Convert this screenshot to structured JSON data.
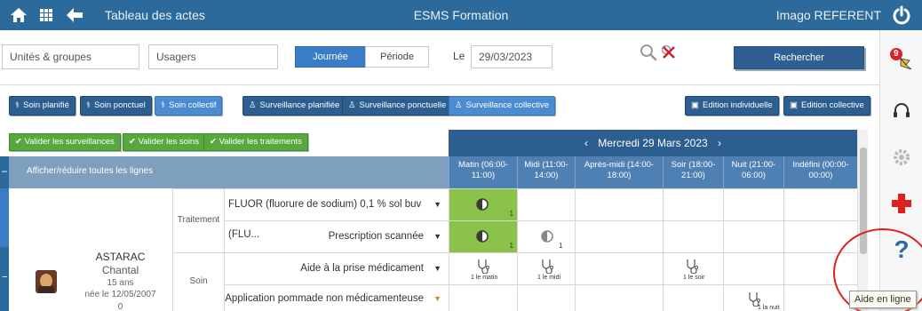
{
  "topbar": {
    "title": "Tableau des actes",
    "center_title": "ESMS Formation",
    "user": "Imago REFERENT"
  },
  "filters": {
    "units_placeholder": "Unités & groupes",
    "users_placeholder": "Usagers",
    "mode_day": "Journée",
    "mode_period": "Période",
    "date_label": "Le",
    "date_value": "29/03/2023",
    "search_label": "Rechercher",
    "notif_count": "9"
  },
  "actions": {
    "soin_planifie": "Soin planifié",
    "soin_ponctuel": "Soin ponctuel",
    "soin_collectif": "Soin collectif",
    "surv_planifiee": "Surveillance planifiée",
    "surv_ponctuelle": "Surveillance ponctuelle",
    "surv_collective": "Surveillance collective",
    "edition_individuelle": "Edition individuelle",
    "edition_collective": "Edition collective"
  },
  "validate": {
    "surveillances": "Valider les surveillances",
    "soins": "Valider les soins",
    "traitements": "Valider les traitements"
  },
  "calendar": {
    "prev": "‹",
    "date": "Mercredi 29 Mars 2023",
    "next": "›",
    "toggle_label": "Afficher/réduire toutes les lignes",
    "slots": [
      {
        "line1": "Matin (06:00-",
        "line2": "11:00)"
      },
      {
        "line1": "Midi (11:00-",
        "line2": "14:00)"
      },
      {
        "line1": "Après-midi (14:00-",
        "line2": "18:00)"
      },
      {
        "line1": "Soir (18:00-",
        "line2": "21:00)"
      },
      {
        "line1": "Nuit (21:00-",
        "line2": "06:00)"
      },
      {
        "line1": "Indéfini (00:00-",
        "line2": "00:00)"
      }
    ]
  },
  "patient": {
    "last_name": "ASTARAC",
    "first_name": "Chantal",
    "age": "15 ans",
    "birth": "née le 12/05/2007",
    "extra": "0"
  },
  "rows": {
    "cat_traitement": "Traitement",
    "cat_soin": "Soin",
    "act1": "FLUOR (fluorure de sodium) 0,1 % sol buv (FLU...",
    "act2": "Prescription scannée",
    "act3": "Aide à la prise médicament",
    "act4": "Application pommade non médicamenteuse",
    "count1": "1",
    "count2": "1",
    "count3": "1",
    "lbl_matin": "1 le matin",
    "lbl_midi": "1 le midi",
    "lbl_soir": "1 le soir",
    "lbl_nuit": "1 la nuit"
  },
  "tooltip": "Aide en ligne",
  "colors": {
    "topbar": "#2d6a9c",
    "primary": "#2c5e90",
    "accent": "#3a7cc5",
    "green": "#58a83e",
    "cell_green": "#8bc34a"
  }
}
